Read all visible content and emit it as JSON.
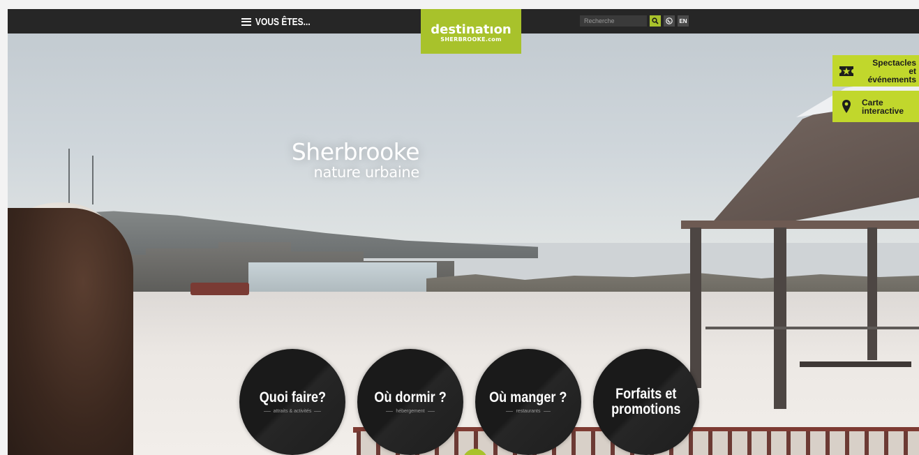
{
  "header": {
    "menu_label": "VOUS ÊTES...",
    "logo_main": "destinatıon",
    "logo_sub": "SHERBROOKE.com",
    "search_placeholder": "Recherche",
    "lang_label": "EN"
  },
  "hero": {
    "title": "Sherbrooke",
    "subtitle": "nature urbaine"
  },
  "side_buttons": [
    {
      "label_line1": "Spectacles",
      "label_line2": "et événements",
      "icon": "star-ticket-icon"
    },
    {
      "label_line1": "Carte",
      "label_line2": "interactive",
      "icon": "map-pin-icon"
    }
  ],
  "circles": [
    {
      "title": "Quoi faire?",
      "subtitle": "attraits & activités"
    },
    {
      "title": "Où dormir ?",
      "subtitle": "hébergement"
    },
    {
      "title": "Où manger ?",
      "subtitle": "restaurants"
    },
    {
      "title_line1": "Forfaits et",
      "title_line2": "promotions"
    }
  ],
  "colors": {
    "accent_green": "#a8c22b",
    "side_green": "#c1d72c",
    "topbar": "#262626",
    "circle": "#1a1a1a"
  }
}
